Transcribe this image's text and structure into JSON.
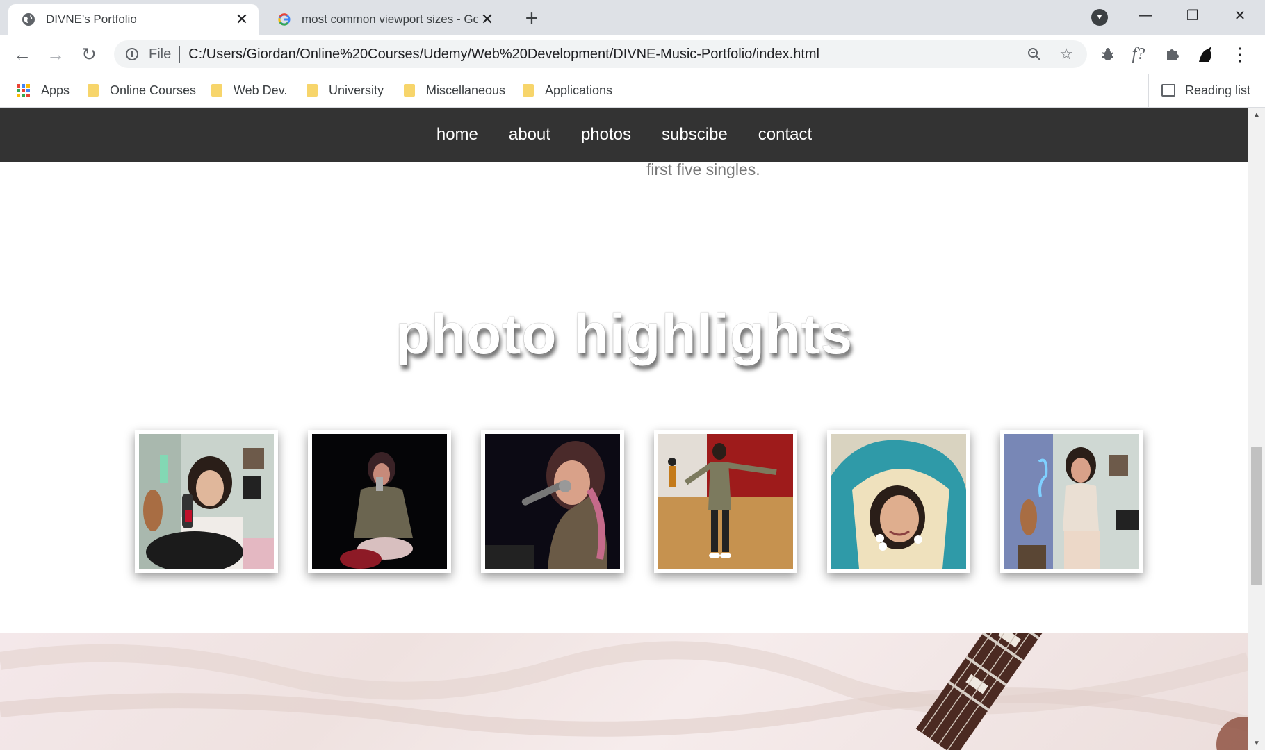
{
  "browser": {
    "tabs": [
      {
        "title": "DIVNE's Portfolio",
        "active": true
      },
      {
        "title": "most common viewport sizes - Google Search",
        "active": false
      }
    ],
    "omnibox": {
      "scheme": "File",
      "url": "C:/Users/Giordan/Online%20Courses/Udemy/Web%20Development/DIVNE-Music-Portfolio/index.html"
    },
    "bookmarks": [
      {
        "label": "Apps",
        "icon": "apps-grid-icon"
      },
      {
        "label": "Online Courses",
        "icon": "folder-icon"
      },
      {
        "label": "Web Dev.",
        "icon": "folder-icon"
      },
      {
        "label": "University",
        "icon": "folder-icon"
      },
      {
        "label": "Miscellaneous",
        "icon": "folder-icon"
      },
      {
        "label": "Applications",
        "icon": "folder-icon"
      }
    ],
    "reading_list": "Reading list"
  },
  "site": {
    "nav": [
      "home",
      "about",
      "photos",
      "subscibe",
      "contact"
    ],
    "intro_tail": "first five singles.",
    "section_title": "photo highlights",
    "photos": [
      "photo-singer-guitar-mic",
      "photo-singer-stage-sitting",
      "photo-singer-stage-closeup",
      "photo-dance-studio",
      "photo-snorlax-hoodie",
      "photo-neon-guitar-room"
    ]
  },
  "colors": {
    "nav_bg": "#333333",
    "tabstrip_bg": "#dee1e6",
    "folder": "#f7d56b"
  }
}
